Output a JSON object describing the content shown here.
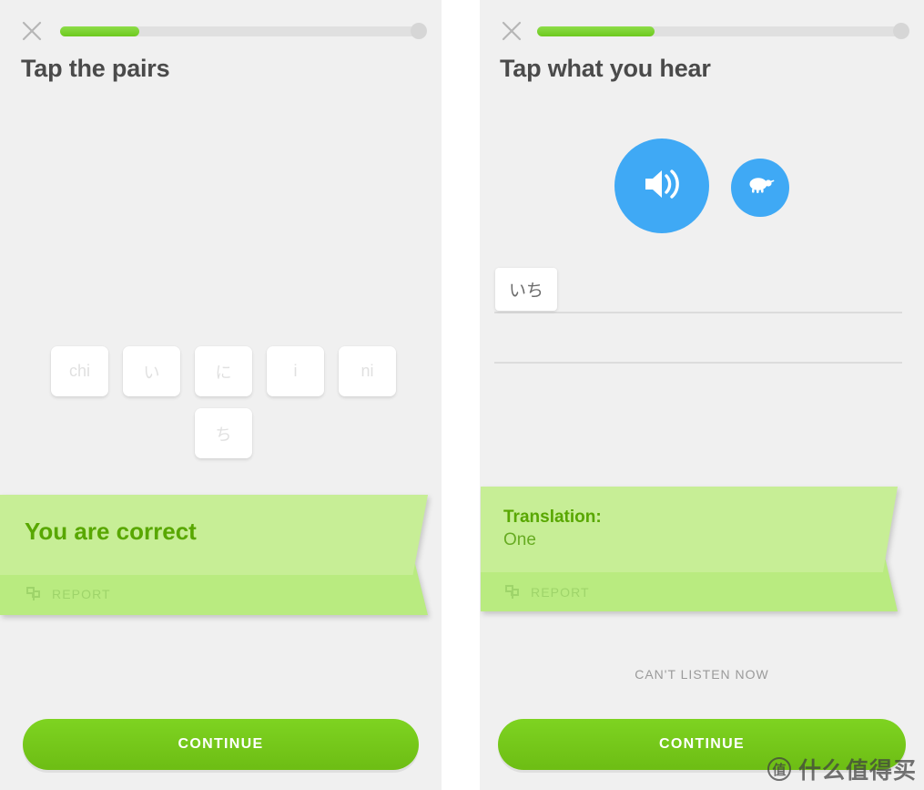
{
  "left_panel": {
    "close_icon": "close-icon",
    "progress": {
      "percent": 22,
      "end_dot": "progress-end-dot"
    },
    "prompt": "Tap the pairs",
    "tiles_row1": [
      {
        "label": "chi"
      },
      {
        "label": "い"
      },
      {
        "label": "に"
      },
      {
        "label": "i"
      },
      {
        "label": "ni"
      }
    ],
    "tiles_row2": [
      {
        "label": "ち"
      }
    ],
    "banner": {
      "title": "You are correct",
      "report_label": "REPORT",
      "report_icon": "flag-report-icon",
      "bg_color": "#c7ee96",
      "bg_color_dark": "#b9eb80",
      "title_color": "#58a700"
    },
    "continue_label": "CONTINUE"
  },
  "right_panel": {
    "close_icon": "close-icon",
    "progress": {
      "percent": 32,
      "end_dot": "progress-end-dot"
    },
    "prompt": "Tap what you hear",
    "audio": {
      "play_icon": "speaker-icon",
      "slow_icon": "turtle-icon",
      "button_color": "#3fa9f5"
    },
    "answer_tiles": [
      {
        "label": "いち"
      }
    ],
    "word_bank": [
      {
        "label": "",
        "state": "available"
      },
      {
        "label": "",
        "state": "available"
      },
      {
        "label": "",
        "state": "used"
      },
      {
        "label": "",
        "state": "available"
      }
    ],
    "banner": {
      "title": "Translation:",
      "subtitle": "One",
      "report_label": "REPORT",
      "report_icon": "flag-report-icon",
      "bg_color": "#c7ee96",
      "bg_color_dark": "#b9eb80",
      "title_color": "#58a700",
      "subtitle_color": "#67ab22"
    },
    "cant_listen_label": "CAN'T LISTEN NOW",
    "continue_label": "CONTINUE"
  },
  "watermark": {
    "badge": "值",
    "text": "什么值得买"
  }
}
